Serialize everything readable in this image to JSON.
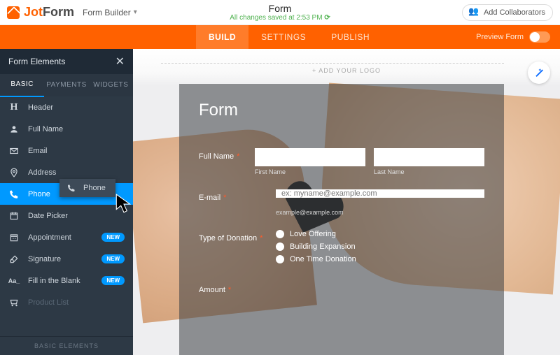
{
  "header": {
    "logo_jot": "Jot",
    "logo_form": "Form",
    "builder": "Form Builder",
    "title": "Form",
    "save_status": "All changes saved at 2:53 PM",
    "collab": "Add Collaborators"
  },
  "nav": {
    "build": "BUILD",
    "settings": "SETTINGS",
    "publish": "PUBLISH",
    "preview": "Preview Form"
  },
  "sidebar": {
    "title": "Form Elements",
    "tabs": {
      "basic": "BASIC",
      "payments": "PAYMENTS",
      "widgets": "WIDGETS"
    },
    "items": [
      {
        "label": "Header"
      },
      {
        "label": "Full Name"
      },
      {
        "label": "Email"
      },
      {
        "label": "Address"
      },
      {
        "label": "Phone"
      },
      {
        "label": "Date Picker"
      },
      {
        "label": "Appointment",
        "badge": "NEW"
      },
      {
        "label": "Signature",
        "badge": "NEW"
      },
      {
        "label": "Fill in the Blank",
        "badge": "NEW"
      },
      {
        "label": "Product List"
      }
    ],
    "footer": "BASIC ELEMENTS",
    "drag_ghost": "Phone"
  },
  "canvas": {
    "add_logo": "+ ADD YOUR LOGO",
    "form_title": "Form",
    "fullname_label": "Full Name",
    "firstname_sub": "First Name",
    "lastname_sub": "Last Name",
    "email_label": "E-mail",
    "email_placeholder": "ex: myname@example.com",
    "email_hint": "example@example.com",
    "donation_label": "Type of Donation",
    "donation_options": [
      "Love Offering",
      "Building Expansion",
      "One Time Donation"
    ],
    "amount_label": "Amount"
  }
}
